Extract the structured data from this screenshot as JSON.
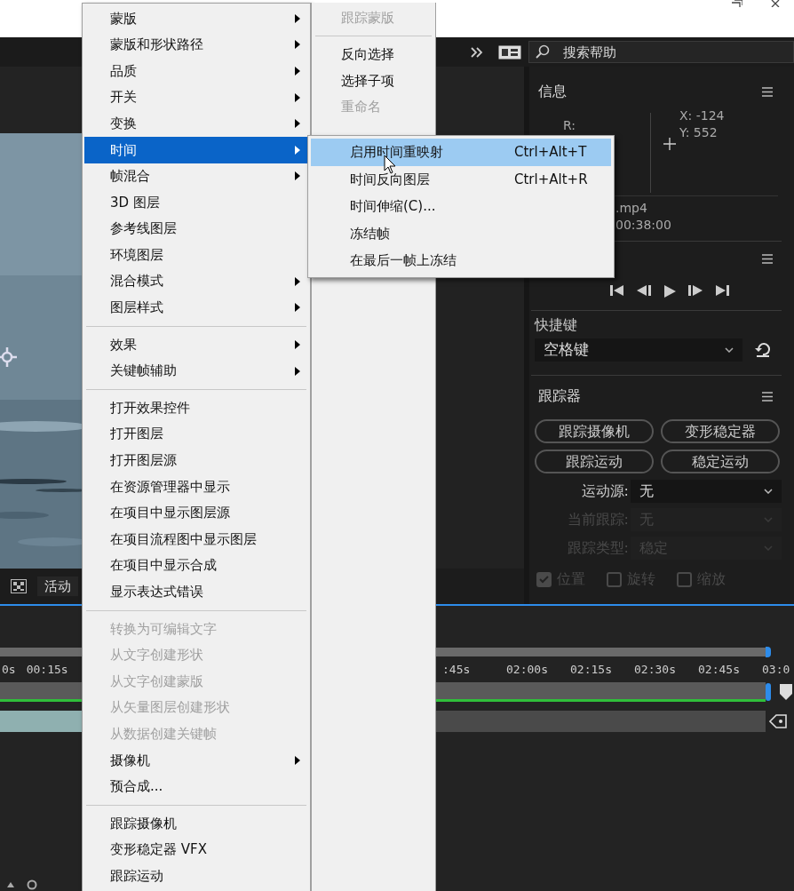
{
  "toolbar": {
    "search": {
      "placeholder": "搜索帮助"
    }
  },
  "viewer": {
    "bottom_bar": {
      "view_label": "活动"
    }
  },
  "info_panel": {
    "title": "信息",
    "r_label": "R:",
    "x_reading": "X: -124",
    "y_reading": "Y: 552",
    "file_name": ".mp4",
    "timecode": "00:38:00"
  },
  "shortcut_panel": {
    "label": "快捷键",
    "value": "空格键"
  },
  "tracker_panel": {
    "title": "跟踪器",
    "buttons": [
      "跟踪摄像机",
      "变形稳定器",
      "跟踪运动",
      "稳定运动"
    ],
    "fields": [
      {
        "label": "运动源:",
        "value": "无",
        "disabled": false
      },
      {
        "label": "当前跟踪:",
        "value": "无",
        "disabled": true
      },
      {
        "label": "跟踪类型:",
        "value": "稳定",
        "disabled": true
      }
    ],
    "checkboxes": [
      {
        "label": "位置",
        "checked": true,
        "disabled": true
      },
      {
        "label": "旋转",
        "checked": false,
        "disabled": true
      },
      {
        "label": "缩放",
        "checked": false,
        "disabled": true
      }
    ]
  },
  "timeline": {
    "ruler_left": [
      "0s",
      "00:15s"
    ],
    "ruler_right": [
      ":45s",
      "02:00s",
      "02:15s",
      "02:30s",
      "02:45s",
      "03:0"
    ]
  },
  "context_menu": {
    "items": [
      {
        "kind": "item",
        "label": "蒙版",
        "submenu": true,
        "disabled": false,
        "selected": false
      },
      {
        "kind": "item",
        "label": "蒙版和形状路径",
        "submenu": true,
        "disabled": false,
        "selected": false
      },
      {
        "kind": "item",
        "label": "品质",
        "submenu": true,
        "disabled": false,
        "selected": false
      },
      {
        "kind": "item",
        "label": "开关",
        "submenu": true,
        "disabled": false,
        "selected": false
      },
      {
        "kind": "item",
        "label": "变换",
        "submenu": true,
        "disabled": false,
        "selected": false
      },
      {
        "kind": "item",
        "label": "时间",
        "submenu": true,
        "disabled": false,
        "selected": true
      },
      {
        "kind": "item",
        "label": "帧混合",
        "submenu": true,
        "disabled": false,
        "selected": false
      },
      {
        "kind": "item",
        "label": "3D 图层",
        "submenu": false,
        "disabled": false,
        "selected": false
      },
      {
        "kind": "item",
        "label": "参考线图层",
        "submenu": false,
        "disabled": false,
        "selected": false
      },
      {
        "kind": "item",
        "label": "环境图层",
        "submenu": false,
        "disabled": false,
        "selected": false
      },
      {
        "kind": "item",
        "label": "混合模式",
        "submenu": true,
        "disabled": false,
        "selected": false
      },
      {
        "kind": "item",
        "label": "图层样式",
        "submenu": true,
        "disabled": false,
        "selected": false
      },
      {
        "kind": "separator"
      },
      {
        "kind": "item",
        "label": "效果",
        "submenu": true,
        "disabled": false,
        "selected": false
      },
      {
        "kind": "item",
        "label": "关键帧辅助",
        "submenu": true,
        "disabled": false,
        "selected": false
      },
      {
        "kind": "separator"
      },
      {
        "kind": "item",
        "label": "打开效果控件",
        "submenu": false,
        "disabled": false,
        "selected": false
      },
      {
        "kind": "item",
        "label": "打开图层",
        "submenu": false,
        "disabled": false,
        "selected": false
      },
      {
        "kind": "item",
        "label": "打开图层源",
        "submenu": false,
        "disabled": false,
        "selected": false
      },
      {
        "kind": "item",
        "label": "在资源管理器中显示",
        "submenu": false,
        "disabled": false,
        "selected": false
      },
      {
        "kind": "item",
        "label": "在项目中显示图层源",
        "submenu": false,
        "disabled": false,
        "selected": false
      },
      {
        "kind": "item",
        "label": "在项目流程图中显示图层",
        "submenu": false,
        "disabled": false,
        "selected": false
      },
      {
        "kind": "item",
        "label": "在项目中显示合成",
        "submenu": false,
        "disabled": false,
        "selected": false
      },
      {
        "kind": "item",
        "label": "显示表达式错误",
        "submenu": false,
        "disabled": false,
        "selected": false
      },
      {
        "kind": "separator"
      },
      {
        "kind": "item",
        "label": "转换为可编辑文字",
        "submenu": false,
        "disabled": true,
        "selected": false
      },
      {
        "kind": "item",
        "label": "从文字创建形状",
        "submenu": false,
        "disabled": true,
        "selected": false
      },
      {
        "kind": "item",
        "label": "从文字创建蒙版",
        "submenu": false,
        "disabled": true,
        "selected": false
      },
      {
        "kind": "item",
        "label": "从矢量图层创建形状",
        "submenu": false,
        "disabled": true,
        "selected": false
      },
      {
        "kind": "item",
        "label": "从数据创建关键帧",
        "submenu": false,
        "disabled": true,
        "selected": false
      },
      {
        "kind": "item",
        "label": "摄像机",
        "submenu": true,
        "disabled": false,
        "selected": false
      },
      {
        "kind": "item",
        "label": "预合成...",
        "submenu": false,
        "disabled": false,
        "selected": false
      },
      {
        "kind": "separator"
      },
      {
        "kind": "item",
        "label": "跟踪摄像机",
        "submenu": false,
        "disabled": false,
        "selected": false
      },
      {
        "kind": "item",
        "label": "变形稳定器 VFX",
        "submenu": false,
        "disabled": false,
        "selected": false
      },
      {
        "kind": "item",
        "label": "跟踪运动",
        "submenu": false,
        "disabled": false,
        "selected": false
      }
    ]
  },
  "side_menu": {
    "items": [
      {
        "kind": "item",
        "label": "跟踪蒙版",
        "disabled": true
      },
      {
        "kind": "separator"
      },
      {
        "kind": "item",
        "label": "反向选择",
        "disabled": false
      },
      {
        "kind": "item",
        "label": "选择子项",
        "disabled": false
      },
      {
        "kind": "item",
        "label": "重命名",
        "disabled": true
      }
    ]
  },
  "time_submenu": {
    "items": [
      {
        "label": "启用时间重映射",
        "shortcut": "Ctrl+Alt+T",
        "selected": true
      },
      {
        "label": "时间反向图层",
        "shortcut": "Ctrl+Alt+R",
        "selected": false
      },
      {
        "label": "时间伸缩(C)...",
        "selected": false
      },
      {
        "label": "冻结帧",
        "selected": false
      },
      {
        "label": "在最后一帧上冻结",
        "selected": false
      }
    ]
  }
}
